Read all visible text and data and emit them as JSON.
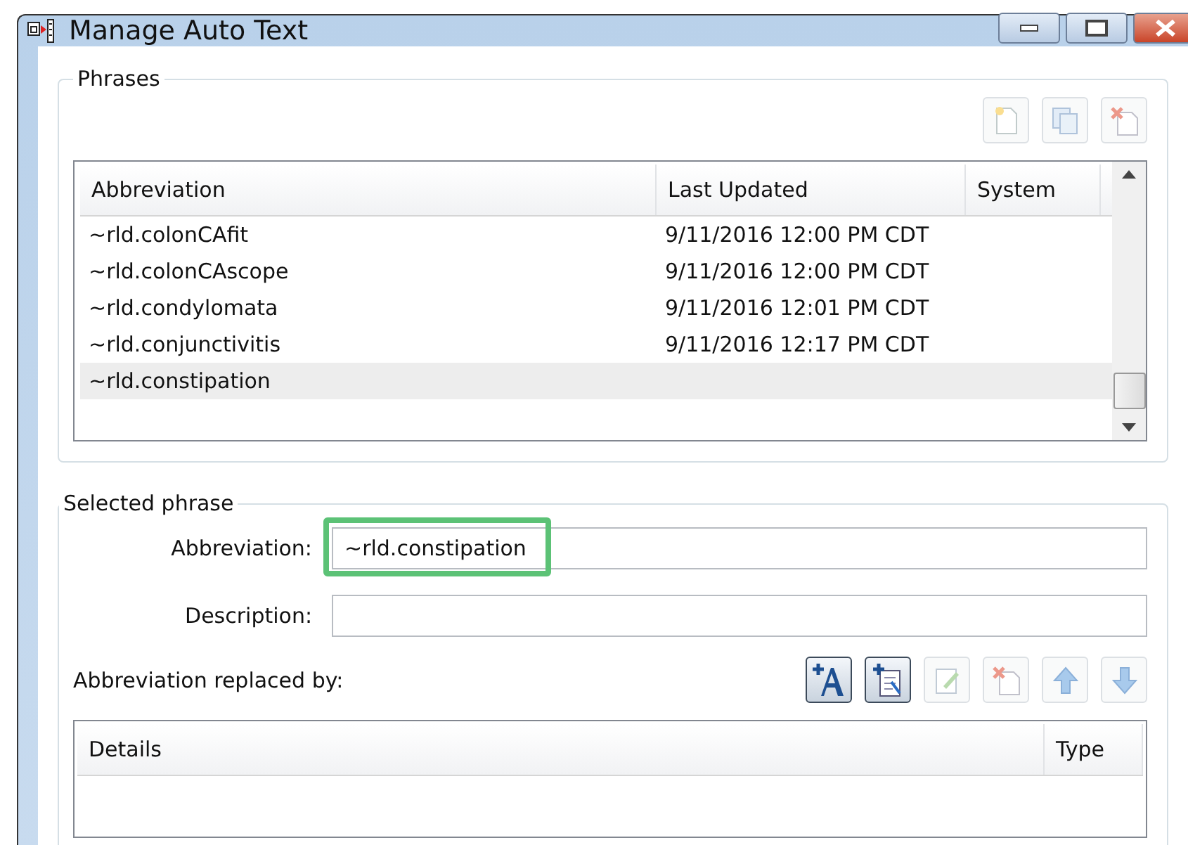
{
  "window": {
    "title": "Manage Auto Text"
  },
  "phrases": {
    "legend": "Phrases",
    "tools": [
      {
        "kind": "new",
        "disabled": true
      },
      {
        "kind": "copy",
        "disabled": true
      },
      {
        "kind": "delete",
        "disabled": true
      }
    ],
    "columns": [
      "Abbreviation",
      "Last Updated",
      "System"
    ],
    "rows": [
      {
        "abbreviation": "~rld.colonCAfit",
        "updated": "9/11/2016 12:00 PM CDT",
        "selected": false
      },
      {
        "abbreviation": "~rld.colonCAscope",
        "updated": "9/11/2016 12:00 PM CDT",
        "selected": false
      },
      {
        "abbreviation": "~rld.condylomata",
        "updated": "9/11/2016 12:01 PM CDT",
        "selected": false
      },
      {
        "abbreviation": "~rld.conjunctivitis",
        "updated": "9/11/2016 12:17 PM CDT",
        "selected": false
      },
      {
        "abbreviation": "~rld.constipation",
        "selected": true
      }
    ]
  },
  "selected_phrase": {
    "legend": "Selected phrase",
    "abbreviation": {
      "label": "Abbreviation:",
      "value": "~rld.constipation",
      "highlighted": true
    },
    "description": {
      "label": "Description:"
    },
    "replaced_label": "Abbreviation replaced by:",
    "tools": [
      {
        "kind": "text",
        "disabled": false
      },
      {
        "kind": "insert",
        "disabled": false
      },
      {
        "kind": "edit",
        "disabled": true
      },
      {
        "kind": "delete",
        "disabled": true
      },
      {
        "kind": "up",
        "disabled": true
      },
      {
        "kind": "down",
        "disabled": true
      }
    ],
    "columns": [
      "Details",
      "Type"
    ]
  }
}
